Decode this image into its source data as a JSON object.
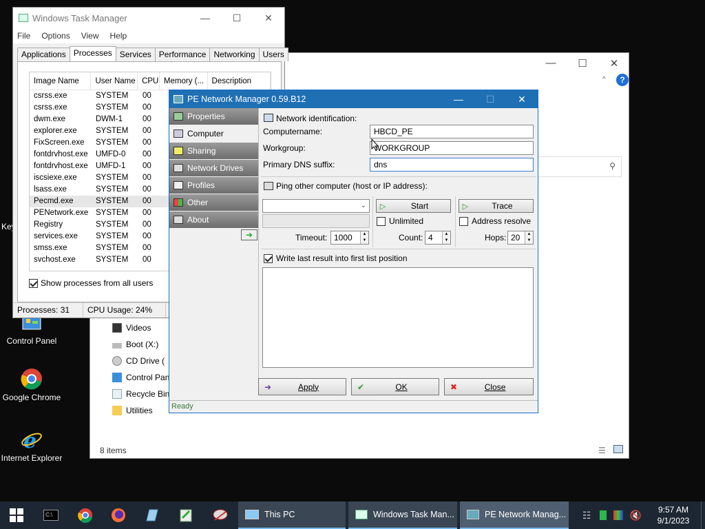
{
  "desktop": {
    "icons": [
      {
        "label": "Control Panel",
        "icon": "control-panel-icon"
      },
      {
        "label": "Google Chrome",
        "icon": "chrome-icon"
      },
      {
        "label": "Internet Explorer",
        "icon": "internet-explorer-icon"
      }
    ],
    "partial_label": "Key"
  },
  "explorer": {
    "nav": [
      {
        "label": "Videos",
        "icon": "videos-icon"
      },
      {
        "label": "Boot (X:)",
        "icon": "drive-icon"
      },
      {
        "label": "CD Drive (",
        "icon": "cd-drive-icon"
      },
      {
        "label": "Control Pan",
        "icon": "control-panel-icon"
      },
      {
        "label": "Recycle Bin",
        "icon": "recycle-bin-icon"
      },
      {
        "label": "Utilities",
        "icon": "folder-icon"
      }
    ],
    "status": "8 items"
  },
  "taskmgr": {
    "title": "Windows Task Manager",
    "menu": [
      "File",
      "Options",
      "View",
      "Help"
    ],
    "tabs": [
      "Applications",
      "Processes",
      "Services",
      "Performance",
      "Networking",
      "Users"
    ],
    "active_tab": "Processes",
    "columns": [
      "Image Name",
      "User Name",
      "CPU",
      "Memory (...",
      "Description"
    ],
    "rows": [
      [
        "csrss.exe",
        "SYSTEM",
        "00"
      ],
      [
        "csrss.exe",
        "SYSTEM",
        "00"
      ],
      [
        "dwm.exe",
        "DWM-1",
        "00"
      ],
      [
        "explorer.exe",
        "SYSTEM",
        "00"
      ],
      [
        "FixScreen.exe",
        "SYSTEM",
        "00"
      ],
      [
        "fontdrvhost.exe",
        "UMFD-0",
        "00"
      ],
      [
        "fontdrvhost.exe",
        "UMFD-1",
        "00"
      ],
      [
        "iscsiexe.exe",
        "SYSTEM",
        "00"
      ],
      [
        "lsass.exe",
        "SYSTEM",
        "00"
      ],
      [
        "Pecmd.exe",
        "SYSTEM",
        "00"
      ],
      [
        "PENetwork.exe",
        "SYSTEM",
        "00"
      ],
      [
        "Registry",
        "SYSTEM",
        "00"
      ],
      [
        "services.exe",
        "SYSTEM",
        "00"
      ],
      [
        "smss.exe",
        "SYSTEM",
        "00"
      ],
      [
        "svchost.exe",
        "SYSTEM",
        "00"
      ]
    ],
    "selected_row": 9,
    "show_all_label": "Show processes from all users",
    "status_processes": "Processes: 31",
    "status_cpu": "CPU Usage: 24%"
  },
  "pen": {
    "title": "PE Network Manager 0.59.B12",
    "sidebar": [
      {
        "label": "Properties",
        "icon": "properties-icon"
      },
      {
        "label": "Computer",
        "icon": "computer-icon"
      },
      {
        "label": "Sharing",
        "icon": "sharing-icon"
      },
      {
        "label": "Network Drives",
        "icon": "network-drives-icon"
      },
      {
        "label": "Profiles",
        "icon": "profiles-icon"
      },
      {
        "label": "Other",
        "icon": "other-icon"
      },
      {
        "label": "About",
        "icon": "about-icon"
      }
    ],
    "active_item": "Computer",
    "netid_header": "Network identification:",
    "computername_label": "Computername:",
    "computername_value": "HBCD_PE",
    "workgroup_label": "Workgroup:",
    "workgroup_value": "WORKGROUP",
    "dns_label": "Primary DNS suffix:",
    "dns_value": "dns",
    "ping_header": "Ping other computer (host or IP address):",
    "start_label": "Start",
    "trace_label": "Trace",
    "unlimited_label": "Unlimited",
    "address_resolve_label": "Address resolve",
    "timeout_label": "Timeout:",
    "timeout_value": "1000",
    "count_label": "Count:",
    "count_value": "4",
    "hops_label": "Hops:",
    "hops_value": "20",
    "write_last_label": "Write last result into first list position",
    "apply_label": "Apply",
    "ok_label": "OK",
    "close_label": "Close",
    "status": "Ready"
  },
  "taskbar": {
    "apps": [
      "This PC",
      "Windows Task Man...",
      "PE Network Manag..."
    ],
    "time": "9:57 AM",
    "date": "9/1/2023"
  }
}
